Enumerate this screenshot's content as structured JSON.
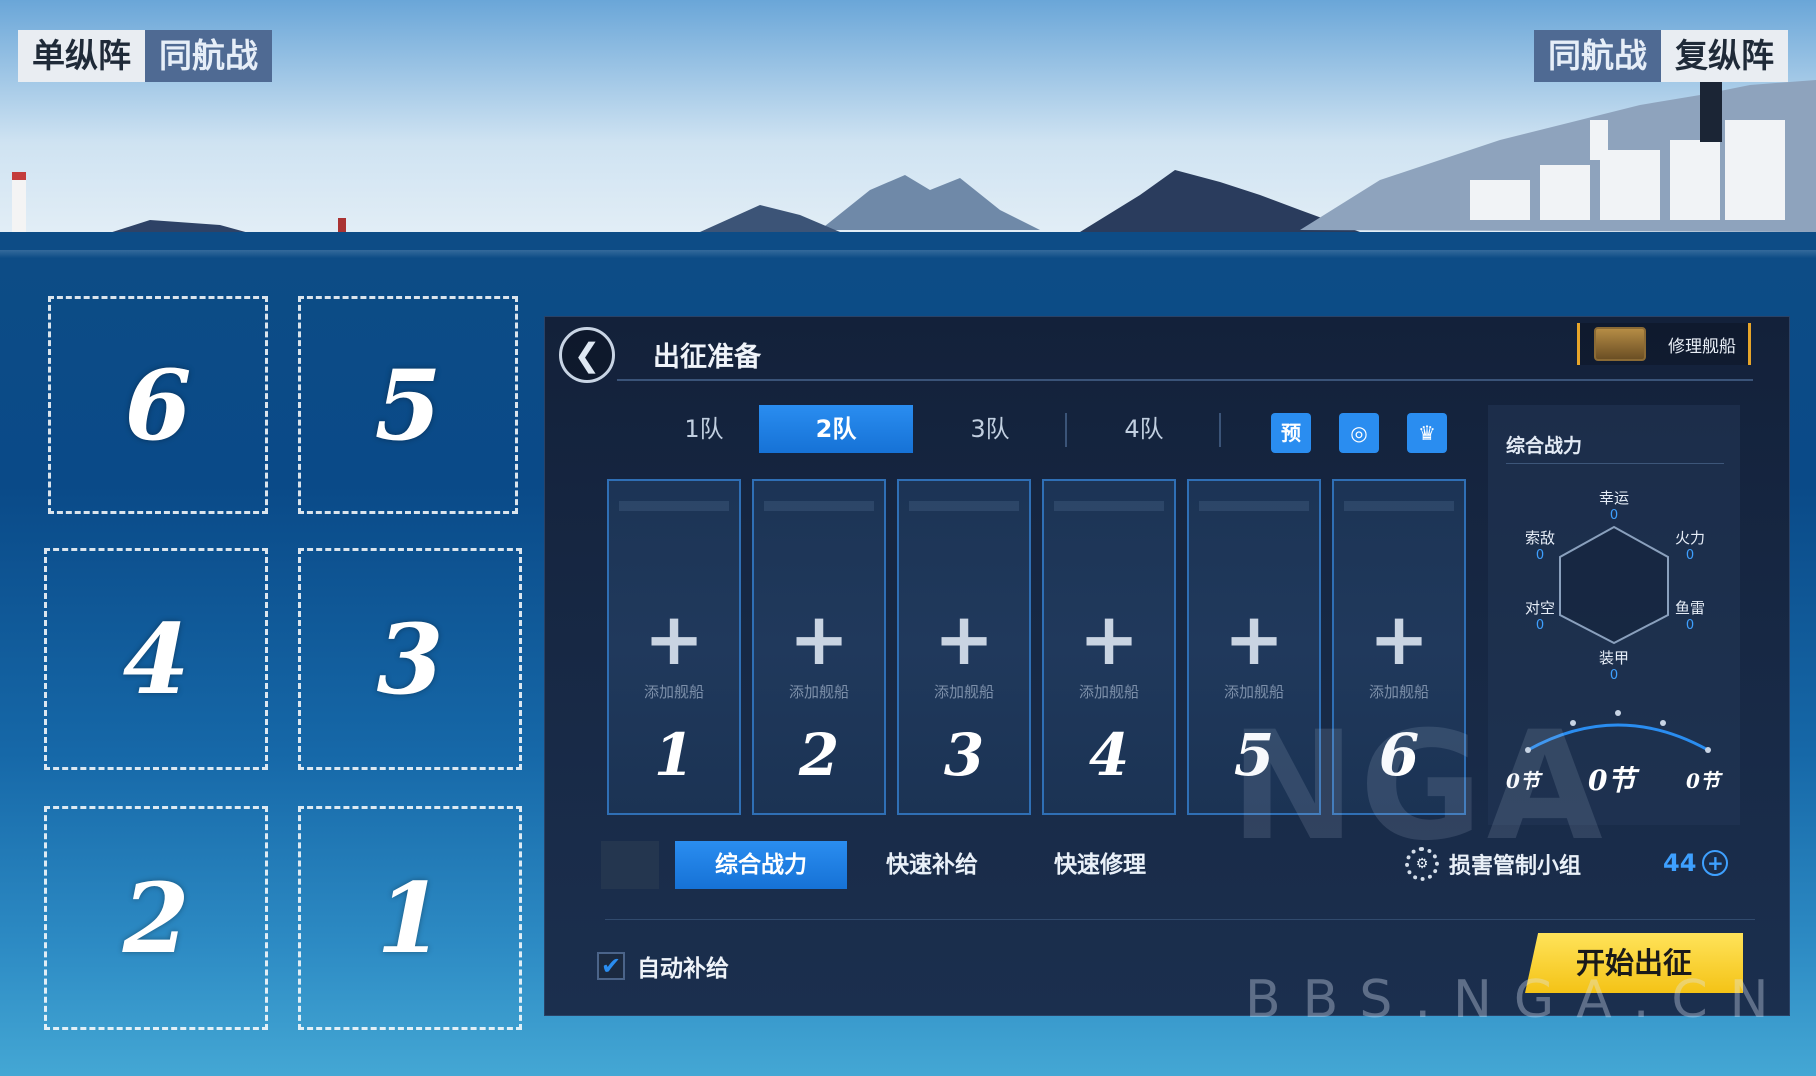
{
  "top_left_tags": {
    "formation": "单纵阵",
    "mode": "同航战"
  },
  "top_right_tags": {
    "mode": "同航战",
    "formation": "复纵阵"
  },
  "formation_grid": [
    "6",
    "5",
    "4",
    "3",
    "2",
    "1"
  ],
  "panel": {
    "title": "出征准备",
    "repair_label": "修理舰船",
    "fleet_tabs": [
      "1队",
      "2队",
      "3队",
      "4队"
    ],
    "active_fleet": "2队",
    "mini_icons": [
      "预"
    ],
    "slots": [
      {
        "label": "添加舰船",
        "num": "1"
      },
      {
        "label": "添加舰船",
        "num": "2"
      },
      {
        "label": "添加舰船",
        "num": "3"
      },
      {
        "label": "添加舰船",
        "num": "4"
      },
      {
        "label": "添加舰船",
        "num": "5"
      },
      {
        "label": "添加舰船",
        "num": "6"
      }
    ],
    "stats": {
      "title": "综合战力",
      "luck": {
        "label": "幸运",
        "value": "0"
      },
      "recon": {
        "label": "索敌",
        "value": "0"
      },
      "firepower": {
        "label": "火力",
        "value": "0"
      },
      "aa": {
        "label": "对空",
        "value": "0"
      },
      "torpedo": {
        "label": "鱼雷",
        "value": "0"
      },
      "armor": {
        "label": "装甲",
        "value": "0"
      },
      "speed_left": "0节",
      "speed_center": "0节",
      "speed_right": "0节"
    },
    "bottom_tabs": [
      "综合战力",
      "快速补给",
      "快速修理"
    ],
    "damage_control_label": "损害管制小组",
    "damage_control_count": "44",
    "auto_supply_label": "自动补给",
    "start_button": "开始出征"
  },
  "watermark": {
    "logo": "NGA",
    "url": "BBS.NGA.CN"
  },
  "colors": {
    "accent_blue": "#2a8df0",
    "start_yellow": "#f4c316",
    "panel_bg": "#182a47"
  }
}
